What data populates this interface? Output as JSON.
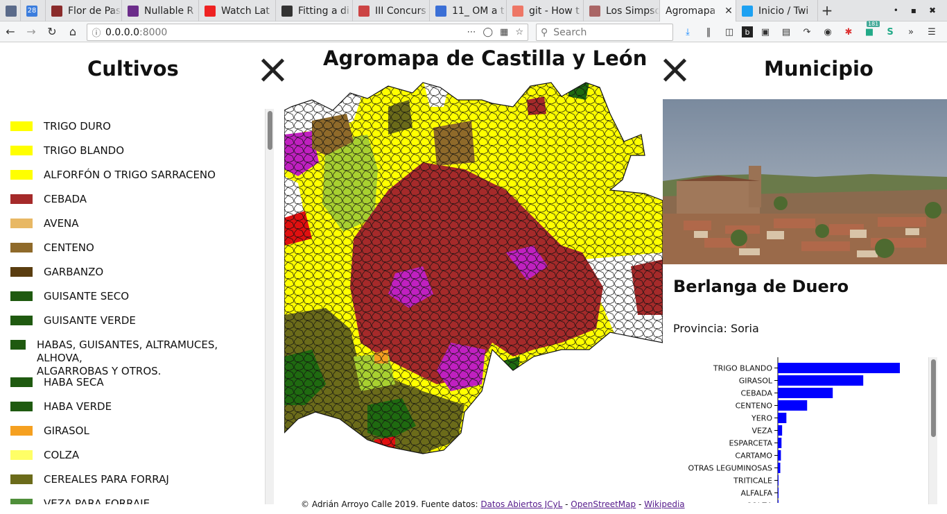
{
  "browser": {
    "tabs": [
      {
        "label": "",
        "color": "#5a6a8a",
        "icon": "bookmark-icon"
      },
      {
        "label": "",
        "color": "#3b7ddd",
        "icon": "calendar-icon",
        "badge": "28"
      },
      {
        "label": "Flor de Pas",
        "color": "#8a2b2b",
        "icon": "shield-icon"
      },
      {
        "label": "Nullable R",
        "color": "#6b2c8a",
        "icon": "circle-icon"
      },
      {
        "label": "Watch Lat",
        "color": "#e22",
        "icon": "youtube-icon"
      },
      {
        "label": "Fitting a di",
        "color": "#333",
        "icon": "cube-icon"
      },
      {
        "label": "III Concurs",
        "color": "#c44",
        "icon": "grid-icon"
      },
      {
        "label": "11_ OM a t",
        "color": "#3b6fd6",
        "icon": "doc-icon"
      },
      {
        "label": "git - How t",
        "color": "#e76",
        "icon": "git-icon"
      },
      {
        "label": "Los Simpso",
        "color": "#a66",
        "icon": "simpsons-icon"
      },
      {
        "label": "Agromapa",
        "color": "",
        "icon": "",
        "active": true
      },
      {
        "label": "Inicio / Twi",
        "color": "#1da1f2",
        "icon": "twitter-icon"
      }
    ],
    "url_host": "0.0.0.0",
    "url_port": ":8000",
    "search_placeholder": "Search",
    "badge_count": "181"
  },
  "page": {
    "title": "Agromapa de Castilla y León",
    "left_title": "Cultivos",
    "right_title": "Municipio",
    "footer": {
      "prefix": "© Adrián Arroyo Calle 2019. Fuente datos: ",
      "link1": "Datos Abiertos JCyL",
      "sep1": " - ",
      "link2": "OpenStreetMap",
      "sep2": " - ",
      "link3": "Wikipedia"
    }
  },
  "legend": [
    {
      "label": "TRIGO DURO",
      "color": "#ffff00"
    },
    {
      "label": "TRIGO BLANDO",
      "color": "#ffff00"
    },
    {
      "label": "ALFORFÓN O TRIGO SARRACENO",
      "color": "#ffff00"
    },
    {
      "label": "CEBADA",
      "color": "#a52a2a"
    },
    {
      "label": "AVENA",
      "color": "#e8b864"
    },
    {
      "label": "CENTENO",
      "color": "#8f6a2a"
    },
    {
      "label": "GARBANZO",
      "color": "#5a3d10"
    },
    {
      "label": "GUISANTE SECO",
      "color": "#1f5a10"
    },
    {
      "label": "GUISANTE VERDE",
      "color": "#1f5a10"
    },
    {
      "label": "HABAS, GUISANTES, ALTRAMUCES, ALHOVA,",
      "label2": "ALGARROBAS Y OTROS.",
      "color": "#1f5a10",
      "indent": true
    },
    {
      "label": "HABA SECA",
      "color": "#1f5a10"
    },
    {
      "label": "HABA VERDE",
      "color": "#1f5a10"
    },
    {
      "label": "GIRASOL",
      "color": "#f5a020"
    },
    {
      "label": "COLZA",
      "color": "#ffff66"
    },
    {
      "label": "CEREALES PARA FORRAJ",
      "color": "#6b6b1a"
    },
    {
      "label": "VEZA PARA FORRAJE",
      "color": "#4f8f3a"
    }
  ],
  "municipio": {
    "name": "Berlanga de Duero",
    "provincia_label": "Provincia: ",
    "provincia": "Soria",
    "photo_alt": "Vista de Berlanga de Duero"
  },
  "chart_data": {
    "type": "bar",
    "orientation": "horizontal",
    "categories": [
      "TRIGO BLANDO",
      "GIRASOL",
      "CEBADA",
      "CENTENO",
      "YERO",
      "VEZA",
      "ESPARCETA",
      "CARTAMO",
      "OTRAS LEGUMINOSAS",
      "TRITICALE",
      "ALFALFA",
      "COLZA"
    ],
    "values": [
      100,
      70,
      45,
      24,
      7,
      3.5,
      3,
      2.5,
      2,
      0.5,
      0.4,
      0.3
    ],
    "bar_color": "#0000ff"
  },
  "map_colors": {
    "yellow": "#ffff00",
    "cebada": "#a52a2a",
    "magenta": "#c020c0",
    "lightgreen": "#a8d030",
    "olive": "#6b6b1a",
    "darkgreen": "#1f6a10",
    "brown": "#8f6a2a",
    "red": "#e01010",
    "orange": "#f5a020"
  }
}
